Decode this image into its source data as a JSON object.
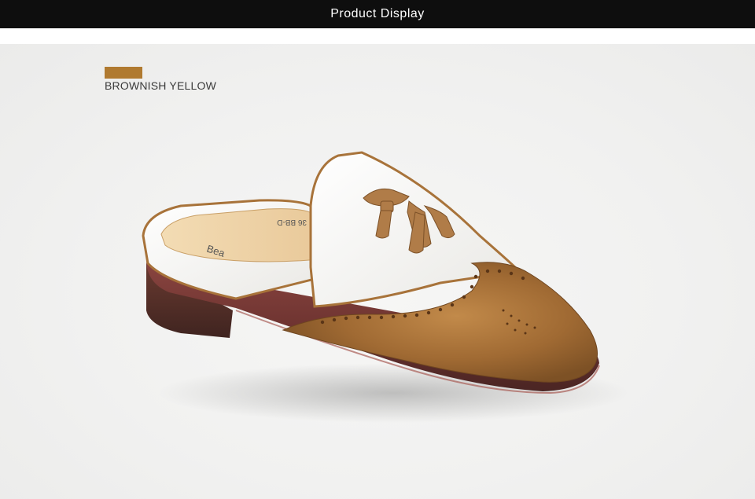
{
  "header": {
    "title": "Product Display"
  },
  "color_option": {
    "swatch_color": "#b07a30",
    "label": "BROWNISH YELLOW"
  },
  "product": {
    "insole_text": "Bea",
    "size_text": "36 BB-D"
  },
  "colors": {
    "header_bg": "#0e0e0e",
    "leather_brown": "#a8733a",
    "leather_white": "#f4f3f0",
    "sole": "#7a3a36"
  }
}
